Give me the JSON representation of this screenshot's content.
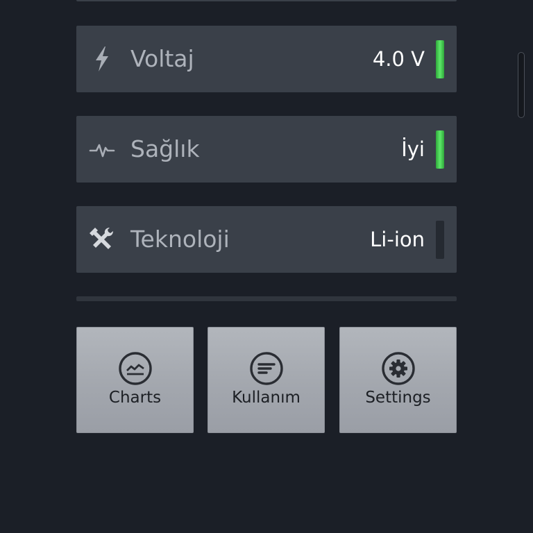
{
  "rows": [
    {
      "label": "Voltaj",
      "value": "4.0 V",
      "icon": "lightning-icon",
      "indicator_active": true
    },
    {
      "label": "Sağlık",
      "value": "İyi",
      "icon": "pulse-icon",
      "indicator_active": true
    },
    {
      "label": "Teknoloji",
      "value": "Li-ion",
      "icon": "tools-icon",
      "indicator_active": false
    }
  ],
  "actions": [
    {
      "label": "Charts",
      "icon": "chart-icon"
    },
    {
      "label": "Kullanım",
      "icon": "list-icon"
    },
    {
      "label": "Settings",
      "icon": "gear-icon"
    }
  ],
  "colors": {
    "background": "#1b1f27",
    "card": "#3a4049",
    "indicator_on": "#4cd75a",
    "indicator_off": "#252a31"
  }
}
